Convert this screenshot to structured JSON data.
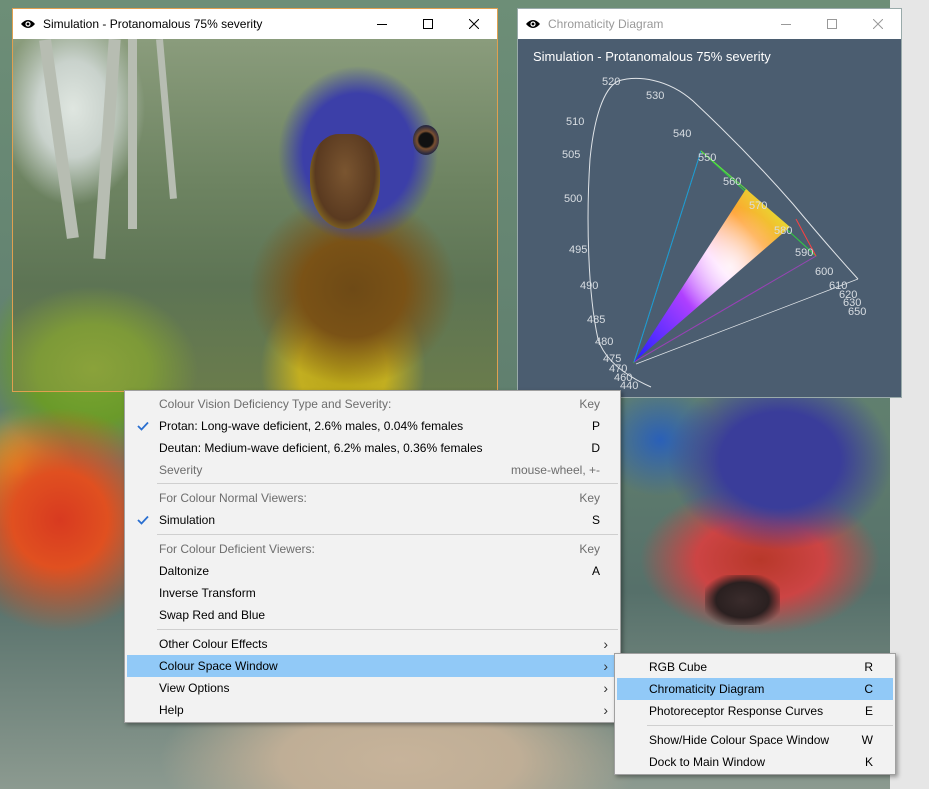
{
  "sim_window": {
    "title": "Simulation - Protanomalous 75% severity"
  },
  "chroma_window": {
    "title": "Chromaticity Diagram",
    "caption": "Simulation - Protanomalous 75% severity",
    "wavelength_labels": [
      "440",
      "460",
      "470",
      "475",
      "480",
      "485",
      "490",
      "495",
      "500",
      "505",
      "510",
      "520",
      "530",
      "540",
      "550",
      "560",
      "570",
      "580",
      "590",
      "600",
      "610",
      "620",
      "630",
      "650"
    ]
  },
  "main_menu": {
    "items": [
      {
        "label": "Colour Vision Deficiency Type and Severity:",
        "key": "Key",
        "disabled": true
      },
      {
        "label": "Protan: Long-wave deficient, 2.6% males, 0.04% females",
        "key": "P",
        "checked": true
      },
      {
        "label": "Deutan: Medium-wave deficient, 6.2% males, 0.36% females",
        "key": "D"
      },
      {
        "label": "Severity",
        "key": "mouse-wheel, +-",
        "disabled": true
      },
      {
        "label": "For Colour Normal Viewers:",
        "key": "Key",
        "disabled": true
      },
      {
        "label": "Simulation",
        "key": "S",
        "checked": true
      },
      {
        "label": "For Colour Deficient Viewers:",
        "key": "Key",
        "disabled": true
      },
      {
        "label": "Daltonize",
        "key": "A"
      },
      {
        "label": "Inverse Transform",
        "key": ""
      },
      {
        "label": "Swap Red and Blue",
        "key": ""
      },
      {
        "label": "Other Colour Effects",
        "key": ""
      },
      {
        "label": "Colour Space Window",
        "key": ""
      },
      {
        "label": "View Options",
        "key": ""
      },
      {
        "label": "Help",
        "key": ""
      }
    ]
  },
  "sub_menu": {
    "items": [
      {
        "label": "RGB Cube",
        "key": "R"
      },
      {
        "label": "Chromaticity Diagram",
        "key": "C"
      },
      {
        "label": "Photoreceptor Response Curves",
        "key": "E"
      },
      {
        "label": "Show/Hide Colour Space Window",
        "key": "W"
      },
      {
        "label": "Dock to Main Window",
        "key": "K"
      }
    ]
  },
  "colors": {
    "highlight": "#91c9f7",
    "chroma_bg": "#4b5d70",
    "sim_border": "#e0a050"
  }
}
